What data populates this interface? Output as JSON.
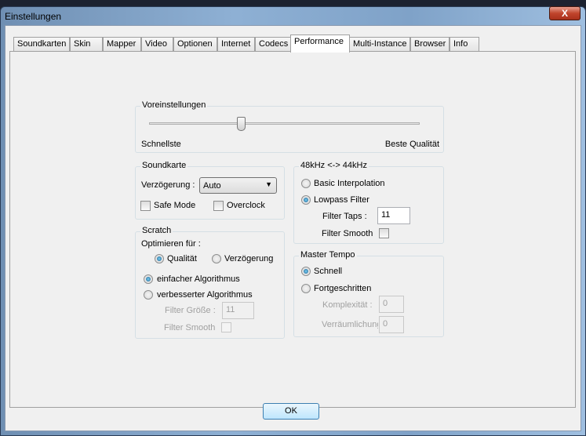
{
  "window": {
    "title": "Einstellungen",
    "close_label": "X"
  },
  "tabs": [
    "Soundkarten",
    "Skin",
    "Mapper",
    "Video",
    "Optionen",
    "Internet",
    "Codecs",
    "Performance",
    "Multi-Instance",
    "Browser",
    "Info"
  ],
  "active_tab": "Performance",
  "presets": {
    "label": "Voreinstellungen",
    "min_label": "Schnellste",
    "max_label": "Beste Qualität",
    "slider_value_fraction": 0.34
  },
  "soundcard": {
    "label": "Soundkarte",
    "latency_label": "Verzögerung :",
    "latency_value": "Auto",
    "safe_mode": "Safe Mode",
    "overclock": "Overclock"
  },
  "scratch": {
    "label": "Scratch",
    "optimize_label": "Optimieren für :",
    "opt_quality": "Qualität",
    "opt_latency": "Verzögerung",
    "simple_algo": "einfacher Algorithmus",
    "improved_algo": "verbesserter Algorithmus",
    "filter_size_label": "Filter Größe :",
    "filter_size_value": "11",
    "filter_smooth": "Filter Smooth"
  },
  "resample": {
    "label": "48kHz <-> 44kHz",
    "basic": "Basic Interpolation",
    "lowpass": "Lowpass Filter",
    "taps_label": "Filter Taps :",
    "taps_value": "11",
    "filter_smooth": "Filter Smooth"
  },
  "master_tempo": {
    "label": "Master Tempo",
    "fast": "Schnell",
    "advanced": "Fortgeschritten",
    "complexity_label": "Komplexität :",
    "complexity_value": "0",
    "spatial_label": "Verräumlichung",
    "spatial_value": "0"
  },
  "ok_label": "OK"
}
